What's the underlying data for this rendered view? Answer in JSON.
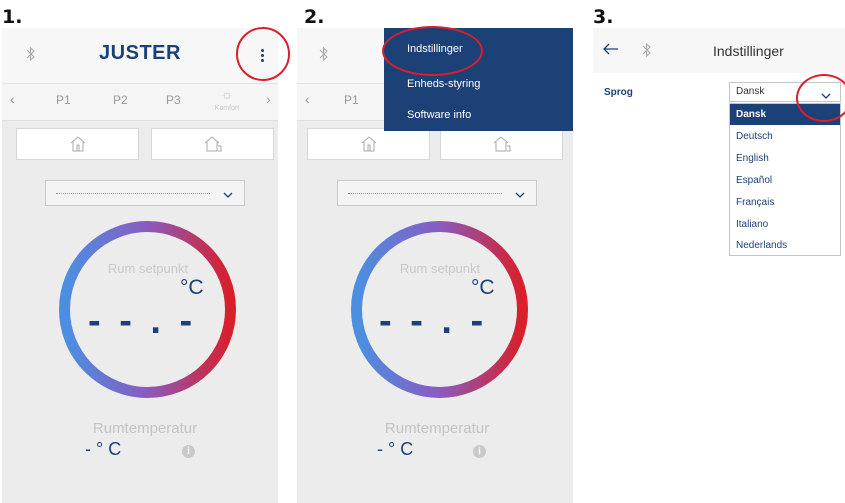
{
  "steps": [
    "1.",
    "2.",
    "3."
  ],
  "phone1": {
    "title": "JUSTER",
    "tabs": [
      "P1",
      "P2",
      "P3"
    ],
    "komfort_label": "Komfort",
    "select_value": "",
    "setpoint_label": "Rum setpunkt",
    "setpoint_unit": "°C",
    "setpoint_value": "- - . -",
    "room_label": "Rumtemperatur",
    "room_value": "- ° C"
  },
  "phone2": {
    "tabs": [
      "P1"
    ],
    "setpoint_label": "Rum setpunkt",
    "setpoint_unit": "°C",
    "setpoint_value": "- - . -",
    "room_label": "Rumtemperatur",
    "room_value": "- ° C",
    "menu": [
      "Indstillinger",
      "Enheds-styring",
      "Software info"
    ]
  },
  "settings": {
    "title": "Indstillinger",
    "language_label": "Sprog",
    "selected": "Dansk",
    "options": [
      "Dansk",
      "Deutsch",
      "English",
      "Español",
      "Français",
      "Italiano",
      "Nederlands"
    ]
  },
  "icons": {
    "bluetooth": "bluetooth-icon",
    "more": "more-vertical-icon",
    "home": "home-icon",
    "away": "house-away-icon",
    "chevron_down": "chevron-down-icon",
    "back": "arrow-left-icon",
    "info": "info-icon",
    "sun": "sun-icon"
  },
  "colors": {
    "brand_blue": "#1c4177",
    "ring_blue": "#4a90e2",
    "ring_red": "#d81f2a",
    "highlight_red": "#d81f2a"
  }
}
